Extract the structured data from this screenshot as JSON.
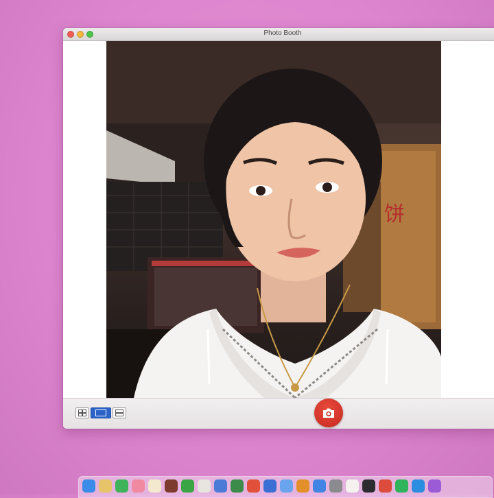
{
  "window": {
    "title": "Photo Booth"
  },
  "photo_sign_text": "饼",
  "controls": {
    "view_modes": [
      {
        "name": "grid-view"
      },
      {
        "name": "single-view"
      },
      {
        "name": "strip-view"
      }
    ],
    "shutter_icon": "camera-icon"
  },
  "dock": {
    "icons": [
      {
        "name": "finder-icon",
        "color": "#3b8be8"
      },
      {
        "name": "notes-icon",
        "color": "#e7c46a"
      },
      {
        "name": "messages-icon",
        "color": "#3fb35a"
      },
      {
        "name": "photos-icon",
        "color": "#ef8aa0"
      },
      {
        "name": "pages-icon",
        "color": "#f3e9cf"
      },
      {
        "name": "video-icon",
        "color": "#7d3b2d"
      },
      {
        "name": "app-icon",
        "color": "#3aa544"
      },
      {
        "name": "folder-icon",
        "color": "#e8e5e0"
      },
      {
        "name": "preview-icon",
        "color": "#4b7bd6"
      },
      {
        "name": "chart-icon",
        "color": "#3c8b4a"
      },
      {
        "name": "browser-icon",
        "color": "#e0503b"
      },
      {
        "name": "music-icon",
        "color": "#3b6fd3"
      },
      {
        "name": "mail-icon",
        "color": "#6aa4ef"
      },
      {
        "name": "pen-icon",
        "color": "#e38f2b"
      },
      {
        "name": "app-store-icon",
        "color": "#4184e4"
      },
      {
        "name": "settings-icon",
        "color": "#8a8a8f"
      },
      {
        "name": "calendar-icon",
        "color": "#f4f1ee"
      },
      {
        "name": "dark-app-icon",
        "color": "#2b2b30"
      },
      {
        "name": "chrome-icon",
        "color": "#dc4b3b"
      },
      {
        "name": "spotify-icon",
        "color": "#2fb35b"
      },
      {
        "name": "skype-icon",
        "color": "#2a8de0"
      },
      {
        "name": "misc-icon",
        "color": "#9b5bd6"
      }
    ]
  }
}
